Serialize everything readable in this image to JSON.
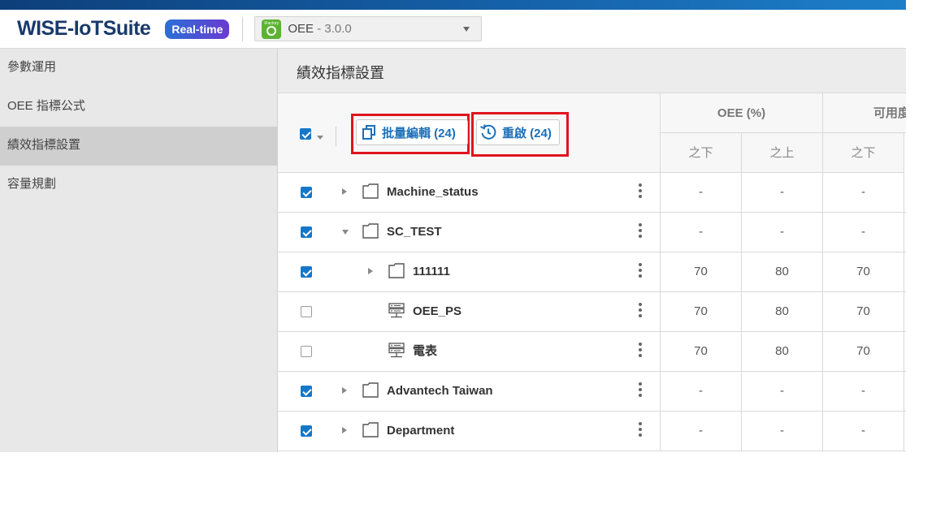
{
  "header": {
    "logo": "WISE-IoTSuite",
    "mode_badge": "Real-time",
    "app_selector": {
      "name": "OEE",
      "version": " - 3.0.0",
      "icon": "gauge-icon",
      "icon_tiny_text": "iFactory"
    }
  },
  "sidebar": {
    "items": [
      {
        "label": "參數運用",
        "active": false
      },
      {
        "label": "OEE 指標公式",
        "active": false
      },
      {
        "label": "績效指標設置",
        "active": true
      },
      {
        "label": "容量規劃",
        "active": false
      }
    ]
  },
  "main": {
    "title": "績效指標設置",
    "toolbar": {
      "batch_edit_label": "批量編輯 (24)",
      "restart_label": "重啟 (24)"
    },
    "columns": {
      "groups": [
        "OEE (%)",
        "可用度"
      ],
      "sub": [
        "之下",
        "之上",
        "之下"
      ]
    },
    "rows": [
      {
        "label": "Machine_status",
        "type": "folder",
        "checked": true,
        "expander": "collapsed",
        "level": 0,
        "values": [
          "-",
          "-",
          "-"
        ]
      },
      {
        "label": "SC_TEST",
        "type": "folder",
        "checked": true,
        "expander": "expanded",
        "level": 0,
        "values": [
          "-",
          "-",
          "-"
        ]
      },
      {
        "label": "111111",
        "type": "folder",
        "checked": true,
        "expander": "collapsed",
        "level": 1,
        "values": [
          "70",
          "80",
          "70"
        ]
      },
      {
        "label": "OEE_PS",
        "type": "device",
        "checked": false,
        "expander": "none",
        "level": 1,
        "values": [
          "70",
          "80",
          "70"
        ]
      },
      {
        "label": "電表",
        "type": "device",
        "checked": false,
        "expander": "none",
        "level": 1,
        "values": [
          "70",
          "80",
          "70"
        ]
      },
      {
        "label": "Advantech Taiwan",
        "type": "folder",
        "checked": true,
        "expander": "collapsed",
        "level": 0,
        "values": [
          "-",
          "-",
          "-"
        ]
      },
      {
        "label": "Department",
        "type": "folder",
        "checked": true,
        "expander": "collapsed",
        "level": 0,
        "values": [
          "-",
          "-",
          "-"
        ]
      }
    ]
  },
  "colors": {
    "accent_blue": "#1b6fb8",
    "checkbox_blue": "#1677c8",
    "highlight_red": "#e0141e",
    "sidebar_bg": "#e8e8e8",
    "sidebar_active": "#cfcfcf"
  }
}
